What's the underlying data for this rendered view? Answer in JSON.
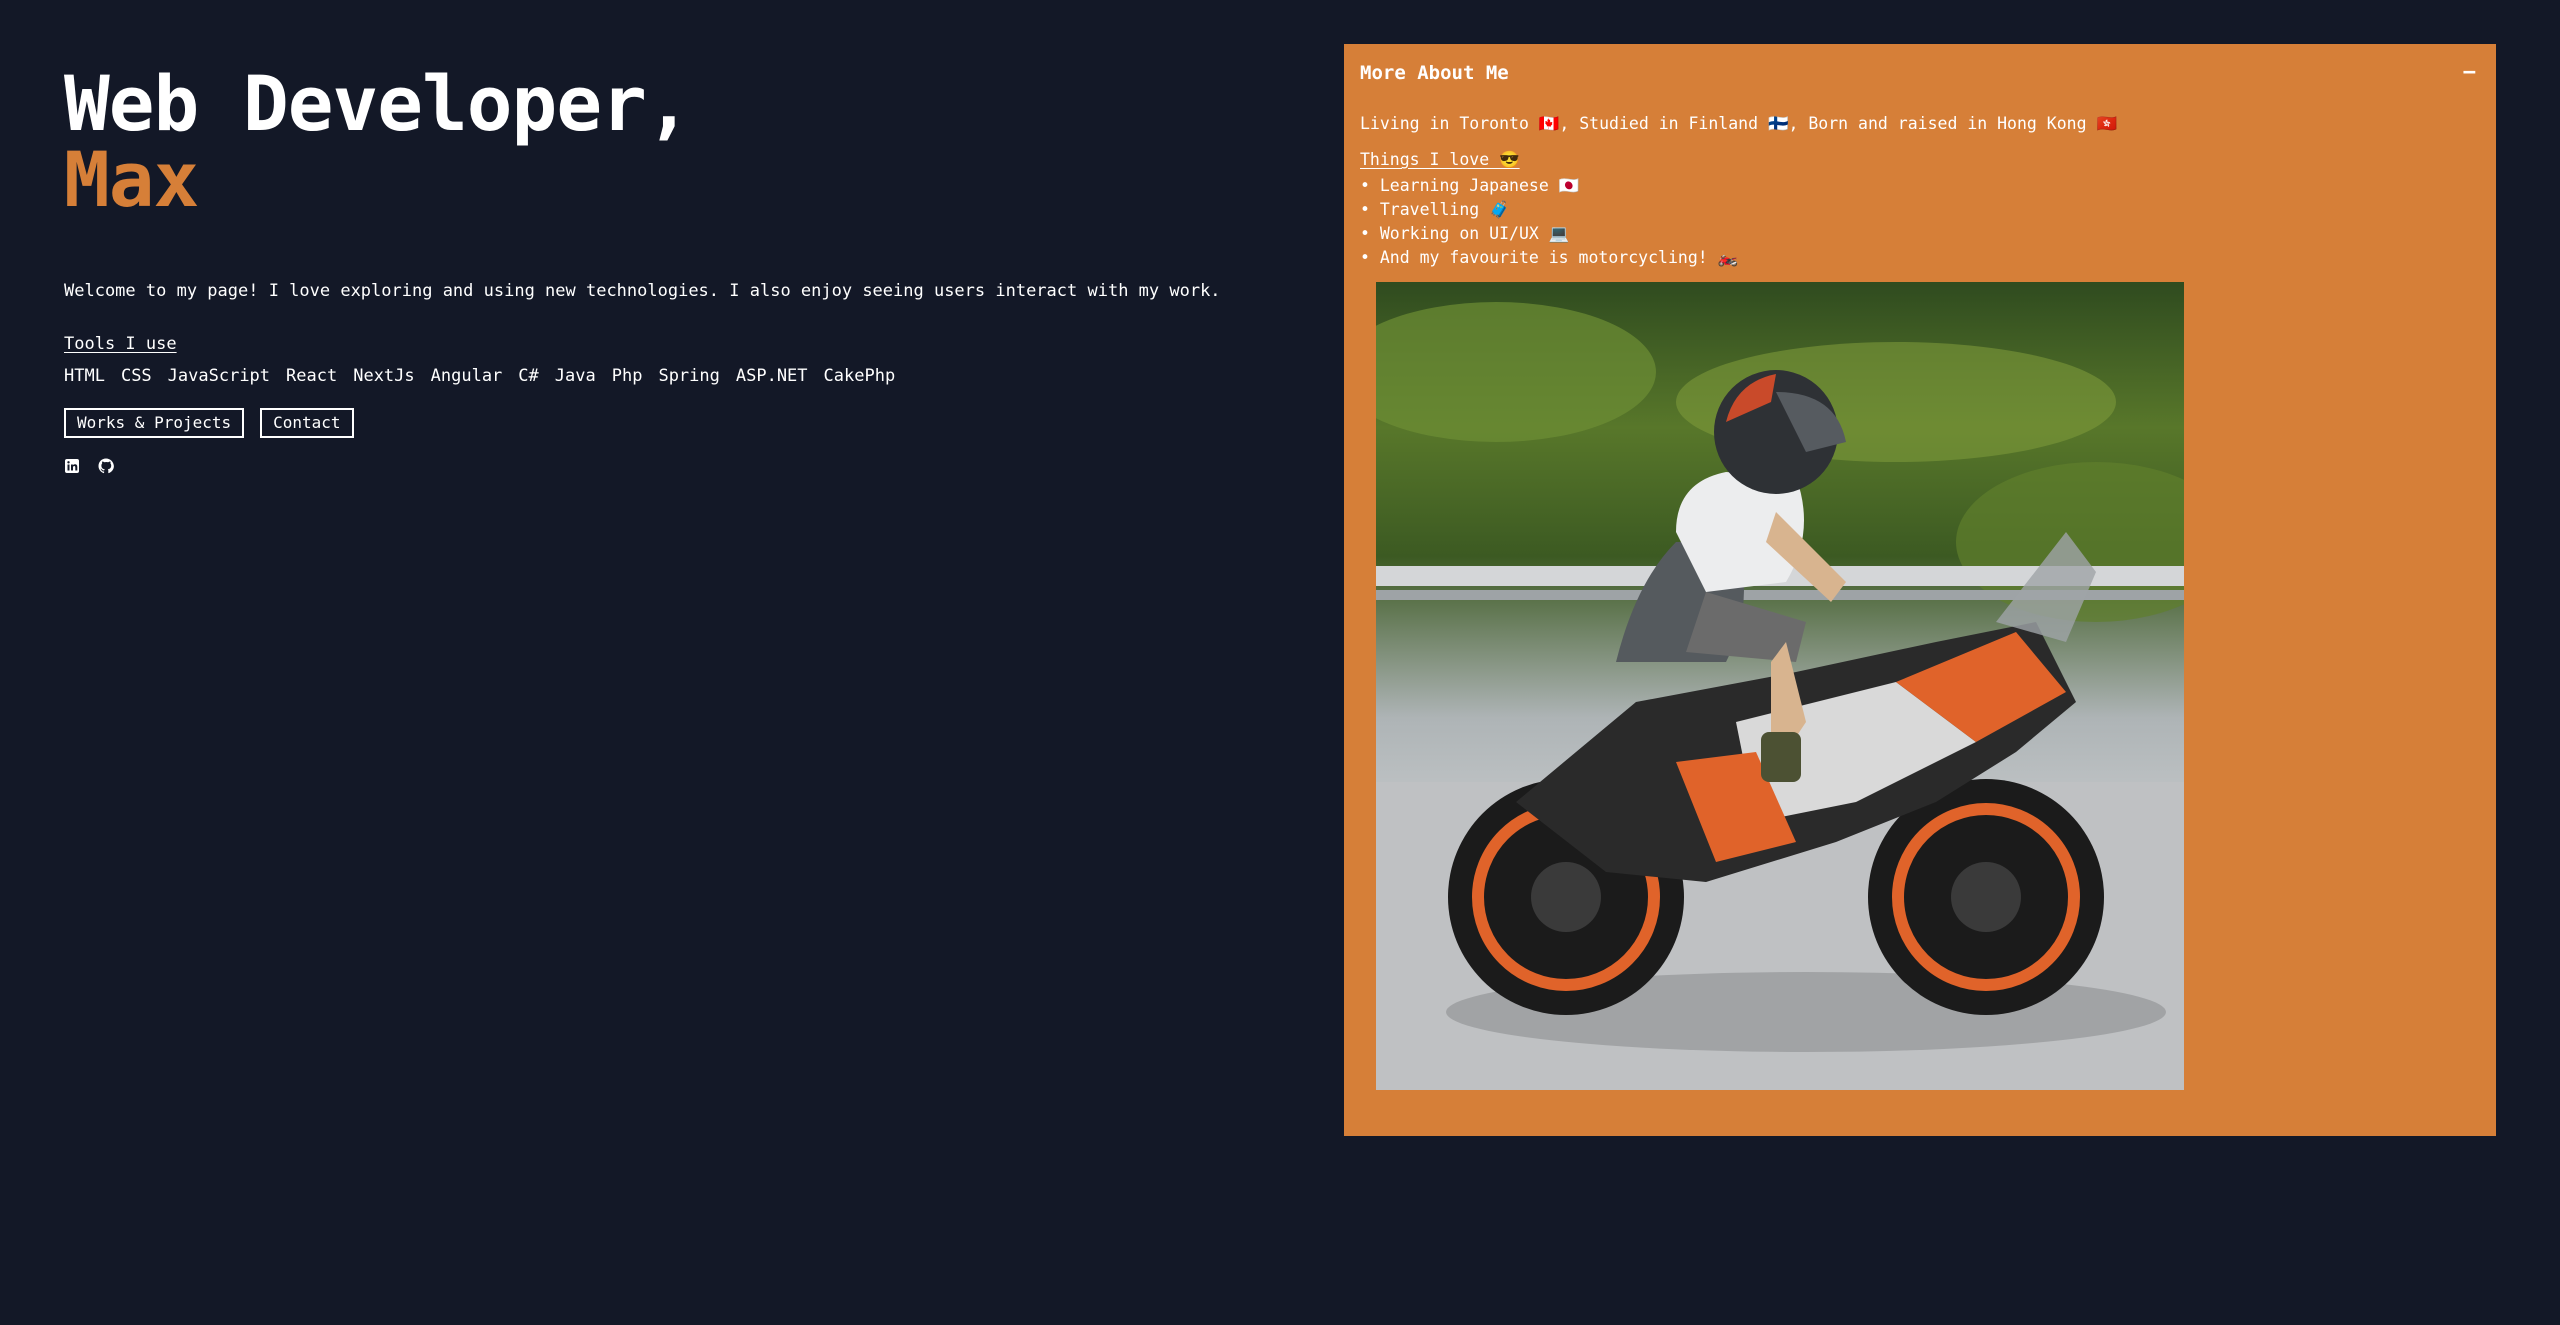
{
  "hero": {
    "title_line1": "Web Developer,",
    "title_line2": "Max",
    "intro": "Welcome to my page! I love exploring and using new technologies. I also enjoy seeing users interact with my work."
  },
  "tools": {
    "heading": "Tools I use",
    "items": [
      "HTML",
      "CSS",
      "JavaScript",
      "React",
      "NextJs",
      "Angular",
      "C#",
      "Java",
      "Php",
      "Spring",
      "ASP.NET",
      "CakePhp"
    ]
  },
  "buttons": {
    "works": "Works & Projects",
    "contact": "Contact"
  },
  "social": {
    "icons": [
      "linkedin-icon",
      "github-icon"
    ]
  },
  "about": {
    "title": "More About Me",
    "minimize": "−",
    "living": "Living in Toronto 🇨🇦, Studied in Finland 🇫🇮, Born and raised in Hong Kong 🇭🇰",
    "things_heading": "Things I love 😎",
    "things": [
      "Learning Japanese 🇯🇵",
      "Travelling 🧳",
      "Working on UI/UX 💻",
      "And my favourite is motorcycling! 🏍️"
    ]
  },
  "colors": {
    "background": "#131827",
    "accent": "#d67f38",
    "text": "#ffffff"
  }
}
